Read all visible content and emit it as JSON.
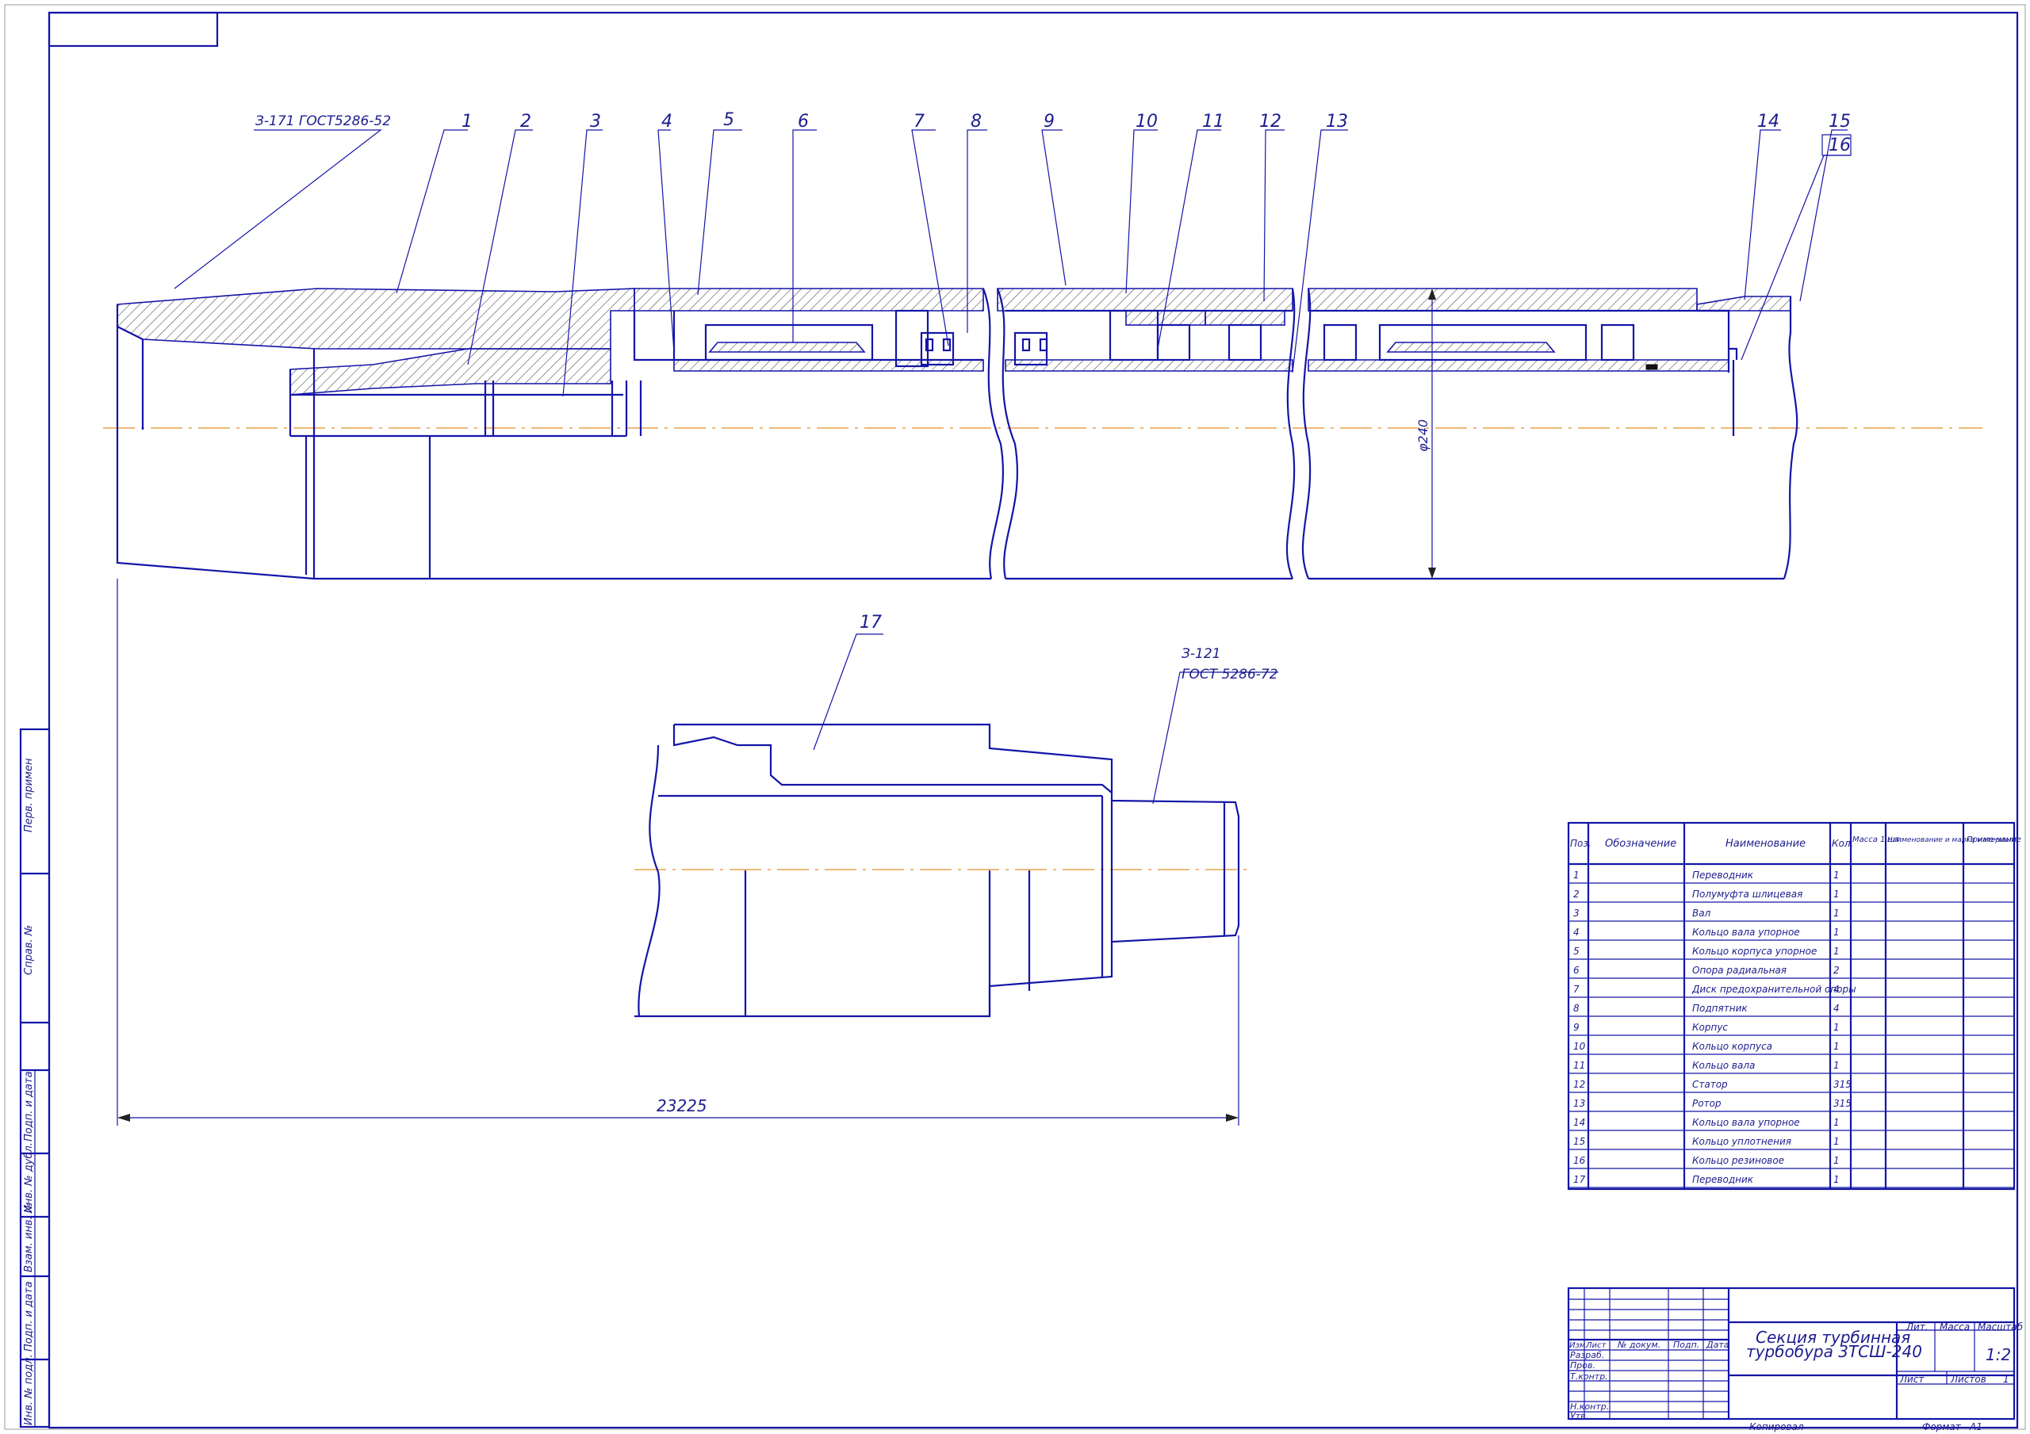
{
  "callouts": [
    "1",
    "2",
    "3",
    "4",
    "5",
    "6",
    "7",
    "8",
    "9",
    "10",
    "11",
    "12",
    "13",
    "14",
    "15",
    "16",
    "17"
  ],
  "thread_top": "З-171 ГОСТ5286-52",
  "thread_bottom_line1": "З-121",
  "thread_bottom_line2": "ГОСТ 5286-72",
  "dim_diameter": "φ240",
  "dim_length": "23225",
  "margin_stamps": [
    "Перв. примен",
    "Справ. №",
    "Подп. и дата",
    "Инв. № дубл.",
    "Взам. инв. №",
    "Подп. и дата",
    "Инв. № подл."
  ],
  "spec_header": {
    "pos": "Поз.",
    "designation": "Обозначение",
    "name": "Наименование",
    "qty": "Кол.",
    "mass": "Масса 1 шт.",
    "material": "Наименование и марка материала",
    "note": "Приме-чание"
  },
  "spec_rows": [
    {
      "pos": "1",
      "name": "Переводник",
      "qty": "1"
    },
    {
      "pos": "2",
      "name": "Полумуфта шлицевая",
      "qty": "1"
    },
    {
      "pos": "3",
      "name": "Вал",
      "qty": "1"
    },
    {
      "pos": "4",
      "name": "Кольцо вала упорное",
      "qty": "1"
    },
    {
      "pos": "5",
      "name": "Кольцо корпуса упорное",
      "qty": "1"
    },
    {
      "pos": "6",
      "name": "Опора радиальная",
      "qty": "2"
    },
    {
      "pos": "7",
      "name": "Диск предохранительной опоры",
      "qty": "4"
    },
    {
      "pos": "8",
      "name": "Подпятник",
      "qty": "4"
    },
    {
      "pos": "9",
      "name": "Корпус",
      "qty": "1"
    },
    {
      "pos": "10",
      "name": "Кольцо корпуса",
      "qty": "1"
    },
    {
      "pos": "11",
      "name": "Кольцо вала",
      "qty": "1"
    },
    {
      "pos": "12",
      "name": "Статор",
      "qty": "315"
    },
    {
      "pos": "13",
      "name": "Ротор",
      "qty": "315"
    },
    {
      "pos": "14",
      "name": "Кольцо вала упорное",
      "qty": "1"
    },
    {
      "pos": "15",
      "name": "Кольцо уплотнения",
      "qty": "1"
    },
    {
      "pos": "16",
      "name": "Кольцо резиновое",
      "qty": "1"
    },
    {
      "pos": "17",
      "name": "Переводник",
      "qty": "1"
    }
  ],
  "title_block": {
    "title_line1": "Секция турбинная",
    "title_line2": "турбобура 3ТСШ-240",
    "izm": "Изм.",
    "list": "Лист",
    "doc": "№ докум.",
    "sign": "Подп.",
    "date": "Дата",
    "razrab": "Разраб.",
    "prov": "Пров.",
    "tkontr": "Т.контр.",
    "nkontr": "Н.контр.",
    "utv": "Утв.",
    "lit": "Лит.",
    "massa": "Масса",
    "masshtab": "Масштаб",
    "scale": "1:2",
    "sheet": "Лист",
    "sheets": "Листов",
    "sheets_val": "1",
    "copied": "Копировал",
    "format": "Формат",
    "format_val": "А1"
  }
}
